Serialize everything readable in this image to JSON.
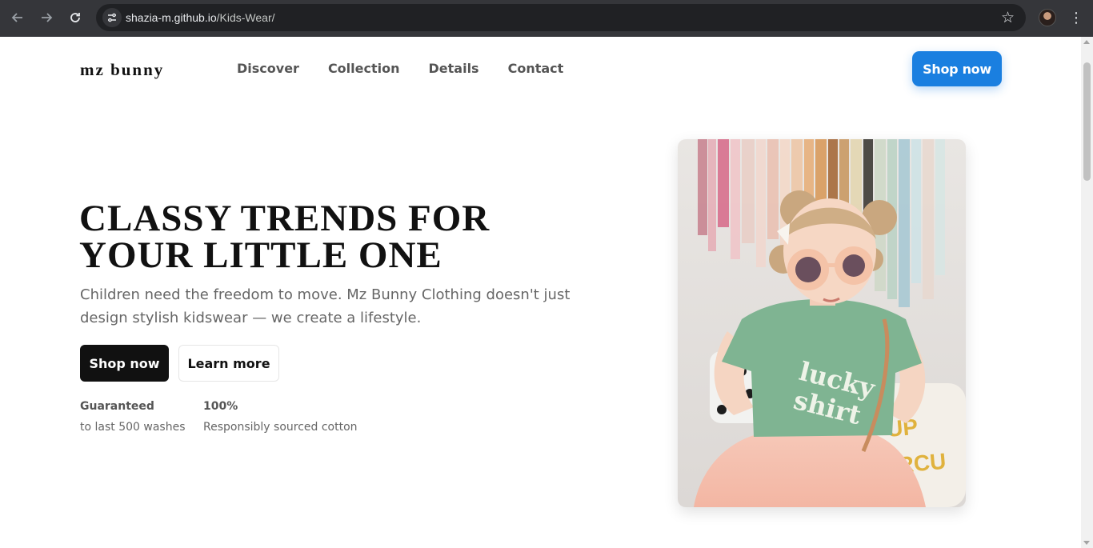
{
  "browser": {
    "url_host": "shazia-m.github.io",
    "url_path": "/Kids-Wear/",
    "icons": [
      "back-icon",
      "forward-icon",
      "reload-icon",
      "site-info-icon",
      "star-icon",
      "profile-avatar",
      "more-menu-icon"
    ]
  },
  "header": {
    "logo": "mz bunny",
    "nav": [
      "Discover",
      "Collection",
      "Details",
      "Contact"
    ],
    "cta": "Shop now"
  },
  "hero": {
    "headline_line1": "CLASSY TRENDS FOR",
    "headline_line2": "YOUR LITTLE ONE",
    "subtitle": "Children need the freedom to move. Mz Bunny Clothing doesn't just design stylish kidswear — we create a lifestyle.",
    "primary_button": "Shop now",
    "secondary_button": "Learn more",
    "stats": [
      {
        "title": "Guaranteed",
        "desc": "to last 500 washes"
      },
      {
        "title": "100%",
        "desc": "Responsibly sourced cotton"
      }
    ]
  },
  "photo": {
    "shirt_text_line1": "lucky",
    "shirt_text_line2": "shirt"
  },
  "colors": {
    "accent": "#1a7fe0",
    "dark_button": "#111111",
    "chrome_bg": "#35363a"
  }
}
